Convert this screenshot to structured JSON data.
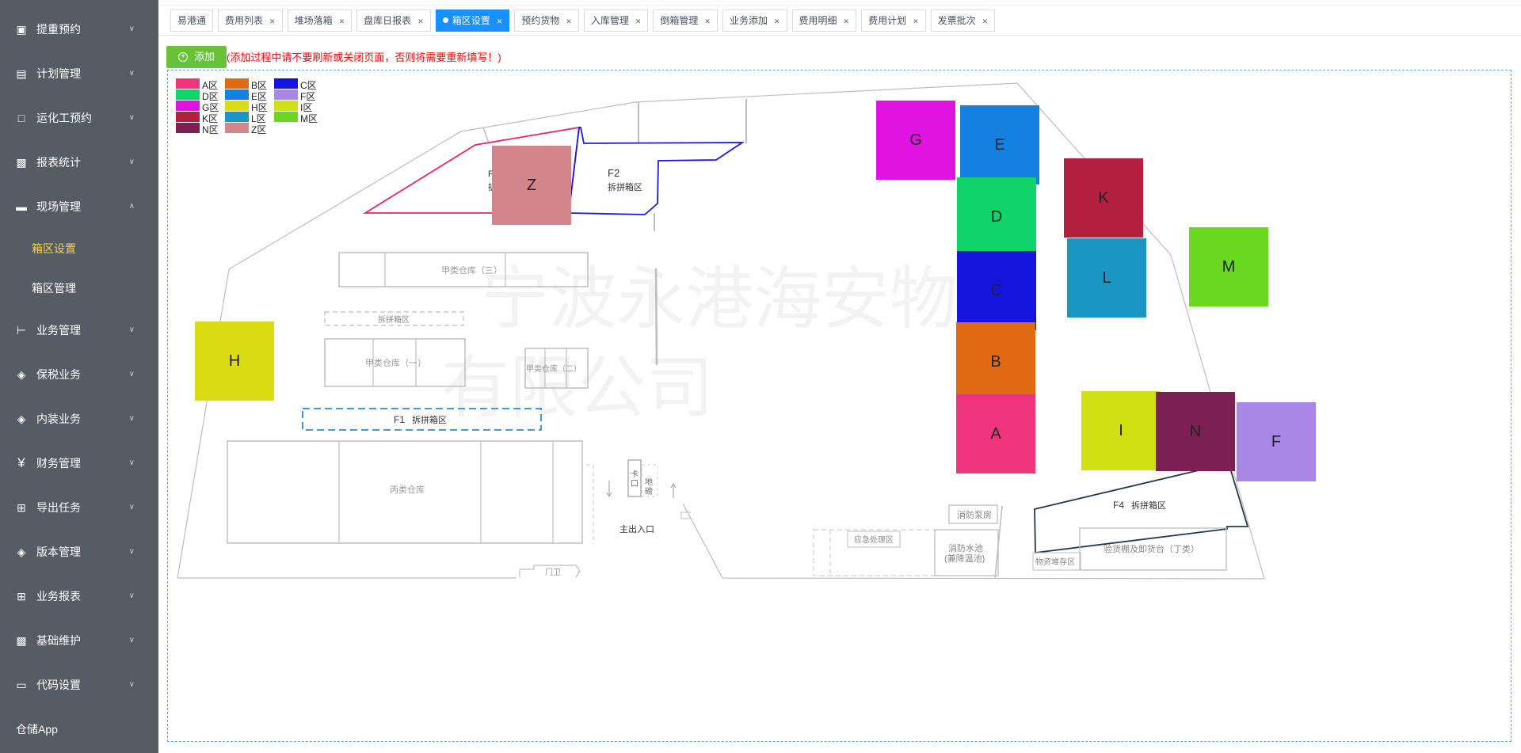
{
  "sidebar": {
    "items": [
      {
        "label": "提重预约",
        "icon": "monitor-icon"
      },
      {
        "label": "计划管理",
        "icon": "document-icon"
      },
      {
        "label": "运化工预约",
        "icon": "picture-icon"
      },
      {
        "label": "报表统计",
        "icon": "report-icon"
      },
      {
        "label": "现场管理",
        "icon": "folder-icon"
      },
      {
        "label": "业务管理",
        "icon": "tree-icon"
      },
      {
        "label": "保税业务",
        "icon": "box-icon"
      },
      {
        "label": "内装业务",
        "icon": "box-icon"
      },
      {
        "label": "财务管理",
        "icon": "yen-icon"
      },
      {
        "label": "导出任务",
        "icon": "grid-icon"
      },
      {
        "label": "版本管理",
        "icon": "box-icon"
      },
      {
        "label": "业务报表",
        "icon": "grid-icon"
      },
      {
        "label": "基础维护",
        "icon": "image-icon"
      },
      {
        "label": "代码设置",
        "icon": "window-icon"
      }
    ],
    "sub_items": [
      "箱区设置",
      "箱区管理"
    ],
    "bottom": "仓储App"
  },
  "tabs": [
    {
      "label": "易港通",
      "closable": false,
      "active": false
    },
    {
      "label": "费用列表",
      "closable": true,
      "active": false
    },
    {
      "label": "堆场落箱",
      "closable": true,
      "active": false
    },
    {
      "label": "盘库日报表",
      "closable": true,
      "active": false
    },
    {
      "label": "箱区设置",
      "closable": true,
      "active": true
    },
    {
      "label": "预约货物",
      "closable": true,
      "active": false
    },
    {
      "label": "入库管理",
      "closable": true,
      "active": false
    },
    {
      "label": "倒箱管理",
      "closable": true,
      "active": false
    },
    {
      "label": "业务添加",
      "closable": true,
      "active": false
    },
    {
      "label": "费用明细",
      "closable": true,
      "active": false
    },
    {
      "label": "费用计划",
      "closable": true,
      "active": false
    },
    {
      "label": "发票批次",
      "closable": true,
      "active": false
    }
  ],
  "toolbar": {
    "add_label": "添加",
    "warning": "(添加过程中请不要刷新或关闭页面，否则将需要重新填写！)"
  },
  "legend": [
    {
      "label": "A区",
      "color": "#f0357c"
    },
    {
      "label": "B区",
      "color": "#e06a14"
    },
    {
      "label": "C区",
      "color": "#1414dc"
    },
    {
      "label": "D区",
      "color": "#10d46a"
    },
    {
      "label": "E区",
      "color": "#1480e0"
    },
    {
      "label": "F区",
      "color": "#a887e6"
    },
    {
      "label": "G区",
      "color": "#e014e0"
    },
    {
      "label": "H区",
      "color": "#dcdc14"
    },
    {
      "label": "I区",
      "color": "#cfe014"
    },
    {
      "label": "K区",
      "color": "#b42040"
    },
    {
      "label": "L区",
      "color": "#1a96c4"
    },
    {
      "label": "M区",
      "color": "#6ad81e"
    },
    {
      "label": "N区",
      "color": "#7c2054"
    },
    {
      "label": "Z区",
      "color": "#d2868c"
    }
  ],
  "zones": [
    {
      "label": "G",
      "color": "#e014e0"
    },
    {
      "label": "E",
      "color": "#1480e0"
    },
    {
      "label": "D",
      "color": "#10d46a"
    },
    {
      "label": "C",
      "color": "#1414dc"
    },
    {
      "label": "B",
      "color": "#e06a14"
    },
    {
      "label": "A",
      "color": "#f0357c"
    },
    {
      "label": "K",
      "color": "#b42040"
    },
    {
      "label": "L",
      "color": "#1a96c4"
    },
    {
      "label": "M",
      "color": "#6ad81e"
    },
    {
      "label": "H",
      "color": "#dcdc14"
    },
    {
      "label": "I",
      "color": "#cfe014"
    },
    {
      "label": "N",
      "color": "#7c2054"
    },
    {
      "label": "F",
      "color": "#a887e6"
    },
    {
      "label": "Z",
      "color": "#d2868c"
    }
  ],
  "map_labels": {
    "f2": "F2",
    "f2_sub": "拆拼箱区",
    "jia3": "甲类仓库（三）",
    "chaipin": "拆拼箱区",
    "jia1": "甲类仓库（一）",
    "jia2": "甲类仓库（二）",
    "f1": "F1",
    "f1_sub": "拆拼箱区",
    "bing": "丙类仓库",
    "kakou": "卡口",
    "dibang": "地磅",
    "main_entrance": "主出入口",
    "menwei": "门卫",
    "xiaofang_beng": "消防泵房",
    "yingji": "应急处理区",
    "xiaofang_chi": "消防水池",
    "xiaofang_chi_sub": "(兼降温池)",
    "f4": "F4",
    "f4_sub": "拆拼箱区",
    "yanhuo": "验货棚及卸货台（丁类）",
    "wuzi": "物资堆存区",
    "watermark_1": "宁波永港海安物流",
    "watermark_2": "有限公司"
  }
}
